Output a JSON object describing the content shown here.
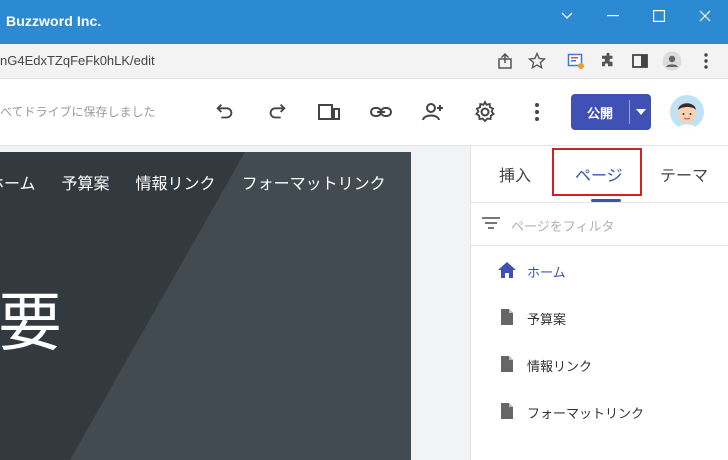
{
  "window": {
    "title": "Buzzword Inc.",
    "controls": [
      "chevron-down-icon",
      "minimize-icon",
      "maximize-icon",
      "close-icon"
    ]
  },
  "address_bar": {
    "url": "nG4EdxTZqFeFk0hLK/edit",
    "icons": [
      "share-icon",
      "star-icon",
      "extension-icon",
      "puzzle-icon",
      "sidepanel-icon",
      "profile-icon",
      "more-vert-icon"
    ]
  },
  "toolbar": {
    "save_status": "べてドライブに保存しました",
    "icons": [
      "undo-icon",
      "redo-icon",
      "preview-icon",
      "link-icon",
      "add-person-icon",
      "settings-icon",
      "more-vert-icon"
    ],
    "publish_label": "公開"
  },
  "site": {
    "nav": [
      "ホーム",
      "予算案",
      "情報リンク",
      "フォーマットリンク"
    ],
    "heading_fragment": "要"
  },
  "panel": {
    "tabs": [
      "挿入",
      "ページ",
      "テーマ"
    ],
    "active_tab": "ページ",
    "filter_placeholder": "ページをフィルタ",
    "pages": [
      {
        "label": "ホーム",
        "icon": "home-icon",
        "active": true
      },
      {
        "label": "予算案",
        "icon": "document-icon",
        "active": false
      },
      {
        "label": "情報リンク",
        "icon": "document-icon",
        "active": false
      },
      {
        "label": "フォーマットリンク",
        "icon": "document-icon",
        "active": false
      }
    ]
  },
  "colors": {
    "titlebar": "#2b8ad1",
    "accent": "#3f51b5",
    "highlight_box": "#d32020",
    "site_background": "#3a4147"
  }
}
